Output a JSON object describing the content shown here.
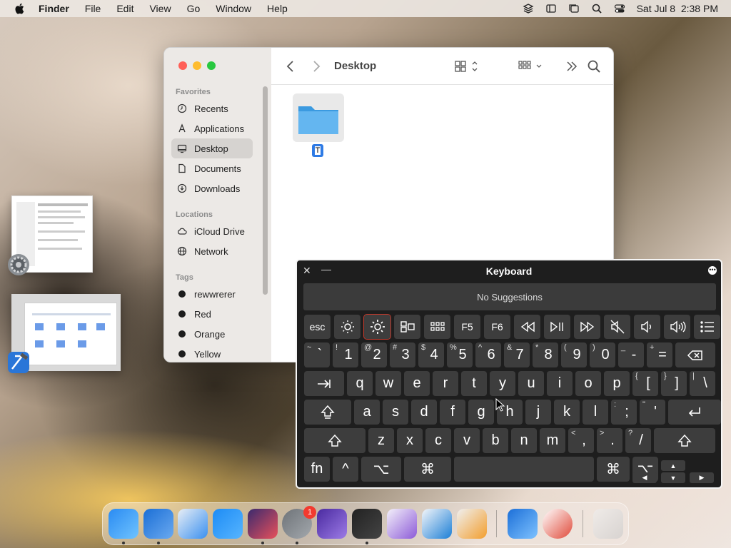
{
  "menubar": {
    "app_name": "Finder",
    "menus": [
      "File",
      "Edit",
      "View",
      "Go",
      "Window",
      "Help"
    ],
    "clock": "Sat Jul 8  2:38 PM"
  },
  "finder": {
    "title": "Desktop",
    "sidebar": {
      "favorites_header": "Favorites",
      "favorites": [
        "Recents",
        "Applications",
        "Desktop",
        "Documents",
        "Downloads"
      ],
      "selected": "Desktop",
      "locations_header": "Locations",
      "locations": [
        "iCloud Drive",
        "Network"
      ],
      "tags_header": "Tags",
      "tags": [
        "rewwrerer",
        "Red",
        "Orange",
        "Yellow"
      ]
    },
    "item": {
      "name": "T",
      "type": "folder"
    }
  },
  "keyboard": {
    "title": "Keyboard",
    "suggestions": "No Suggestions",
    "fn_row": [
      "esc",
      "brightness-down-icon",
      "brightness-up-icon",
      "mission-control-icon",
      "launchpad-icon",
      "F5",
      "F6",
      "rewind-icon",
      "play-pause-icon",
      "fast-forward-icon",
      "mute-icon",
      "volume-down-icon",
      "volume-up-icon",
      "list-icon"
    ],
    "number_row": [
      {
        "top": "~",
        "main": "`"
      },
      {
        "top": "!",
        "main": "1"
      },
      {
        "top": "@",
        "main": "2"
      },
      {
        "top": "#",
        "main": "3"
      },
      {
        "top": "$",
        "main": "4"
      },
      {
        "top": "%",
        "main": "5"
      },
      {
        "top": "^",
        "main": "6"
      },
      {
        "top": "&",
        "main": "7"
      },
      {
        "top": "*",
        "main": "8"
      },
      {
        "top": "(",
        "main": "9"
      },
      {
        "top": ")",
        "main": "0"
      },
      {
        "top": "_",
        "main": "-"
      },
      {
        "top": "+",
        "main": "="
      }
    ],
    "qwerty_row": [
      "q",
      "w",
      "e",
      "r",
      "t",
      "y",
      "u",
      "i",
      "o",
      "p"
    ],
    "qwerty_extra": [
      {
        "top": "{",
        "main": "["
      },
      {
        "top": "}",
        "main": "]"
      },
      {
        "top": "|",
        "main": "\\"
      }
    ],
    "home_row": [
      "a",
      "s",
      "d",
      "f",
      "g",
      "h",
      "j",
      "k",
      "l"
    ],
    "home_extra": [
      {
        "top": ":",
        "main": ";"
      },
      {
        "top": "\"",
        "main": "'"
      }
    ],
    "bottom_row": [
      "z",
      "x",
      "c",
      "v",
      "b",
      "n",
      "m"
    ],
    "bottom_extra": [
      {
        "top": "<",
        "main": ","
      },
      {
        "top": ">",
        "main": "."
      },
      {
        "top": "?",
        "main": "/"
      }
    ],
    "mod_row": {
      "fn": "fn",
      "ctrl": "^",
      "opt": "⌥",
      "cmd": "⌘",
      "cmd_r": "⌘",
      "opt_r": "⌥"
    },
    "arrows": {
      "up": "▲",
      "left": "◀",
      "down": "▼",
      "right": "▶"
    }
  },
  "dock": {
    "apps": [
      "Finder",
      "Xcode",
      "Safari",
      "App Store",
      "Shortcuts",
      "System Settings",
      "Apple Configurator",
      "Terminal",
      "Visual Studio",
      "Visual Studio Code",
      "Launchpad",
      "Weather",
      "Google Chrome",
      "Trash"
    ],
    "system_settings_badge": "1"
  }
}
